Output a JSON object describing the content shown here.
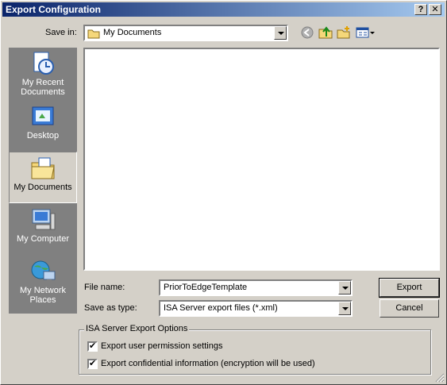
{
  "window": {
    "title": "Export Configuration",
    "help_label": "?",
    "close_label": "✕"
  },
  "lookin": {
    "label": "Save in:",
    "value": "My Documents"
  },
  "places": [
    {
      "label": "My Recent Documents",
      "icon": "recent-documents-icon"
    },
    {
      "label": "Desktop",
      "icon": "desktop-icon"
    },
    {
      "label": "My Documents",
      "icon": "my-documents-icon",
      "selected": true
    },
    {
      "label": "My Computer",
      "icon": "my-computer-icon"
    },
    {
      "label": "My Network Places",
      "icon": "network-places-icon"
    }
  ],
  "filename": {
    "label": "File name:",
    "value": "PriorToEdgeTemplate"
  },
  "savetype": {
    "label": "Save as type:",
    "value": "ISA Server export files (*.xml)"
  },
  "buttons": {
    "export": "Export",
    "cancel": "Cancel"
  },
  "options": {
    "legend": "ISA Server Export Options",
    "user_permissions": {
      "label": "Export user permission settings",
      "checked": true
    },
    "confidential": {
      "label": "Export confidential information (encryption will be used)",
      "checked": true
    }
  }
}
